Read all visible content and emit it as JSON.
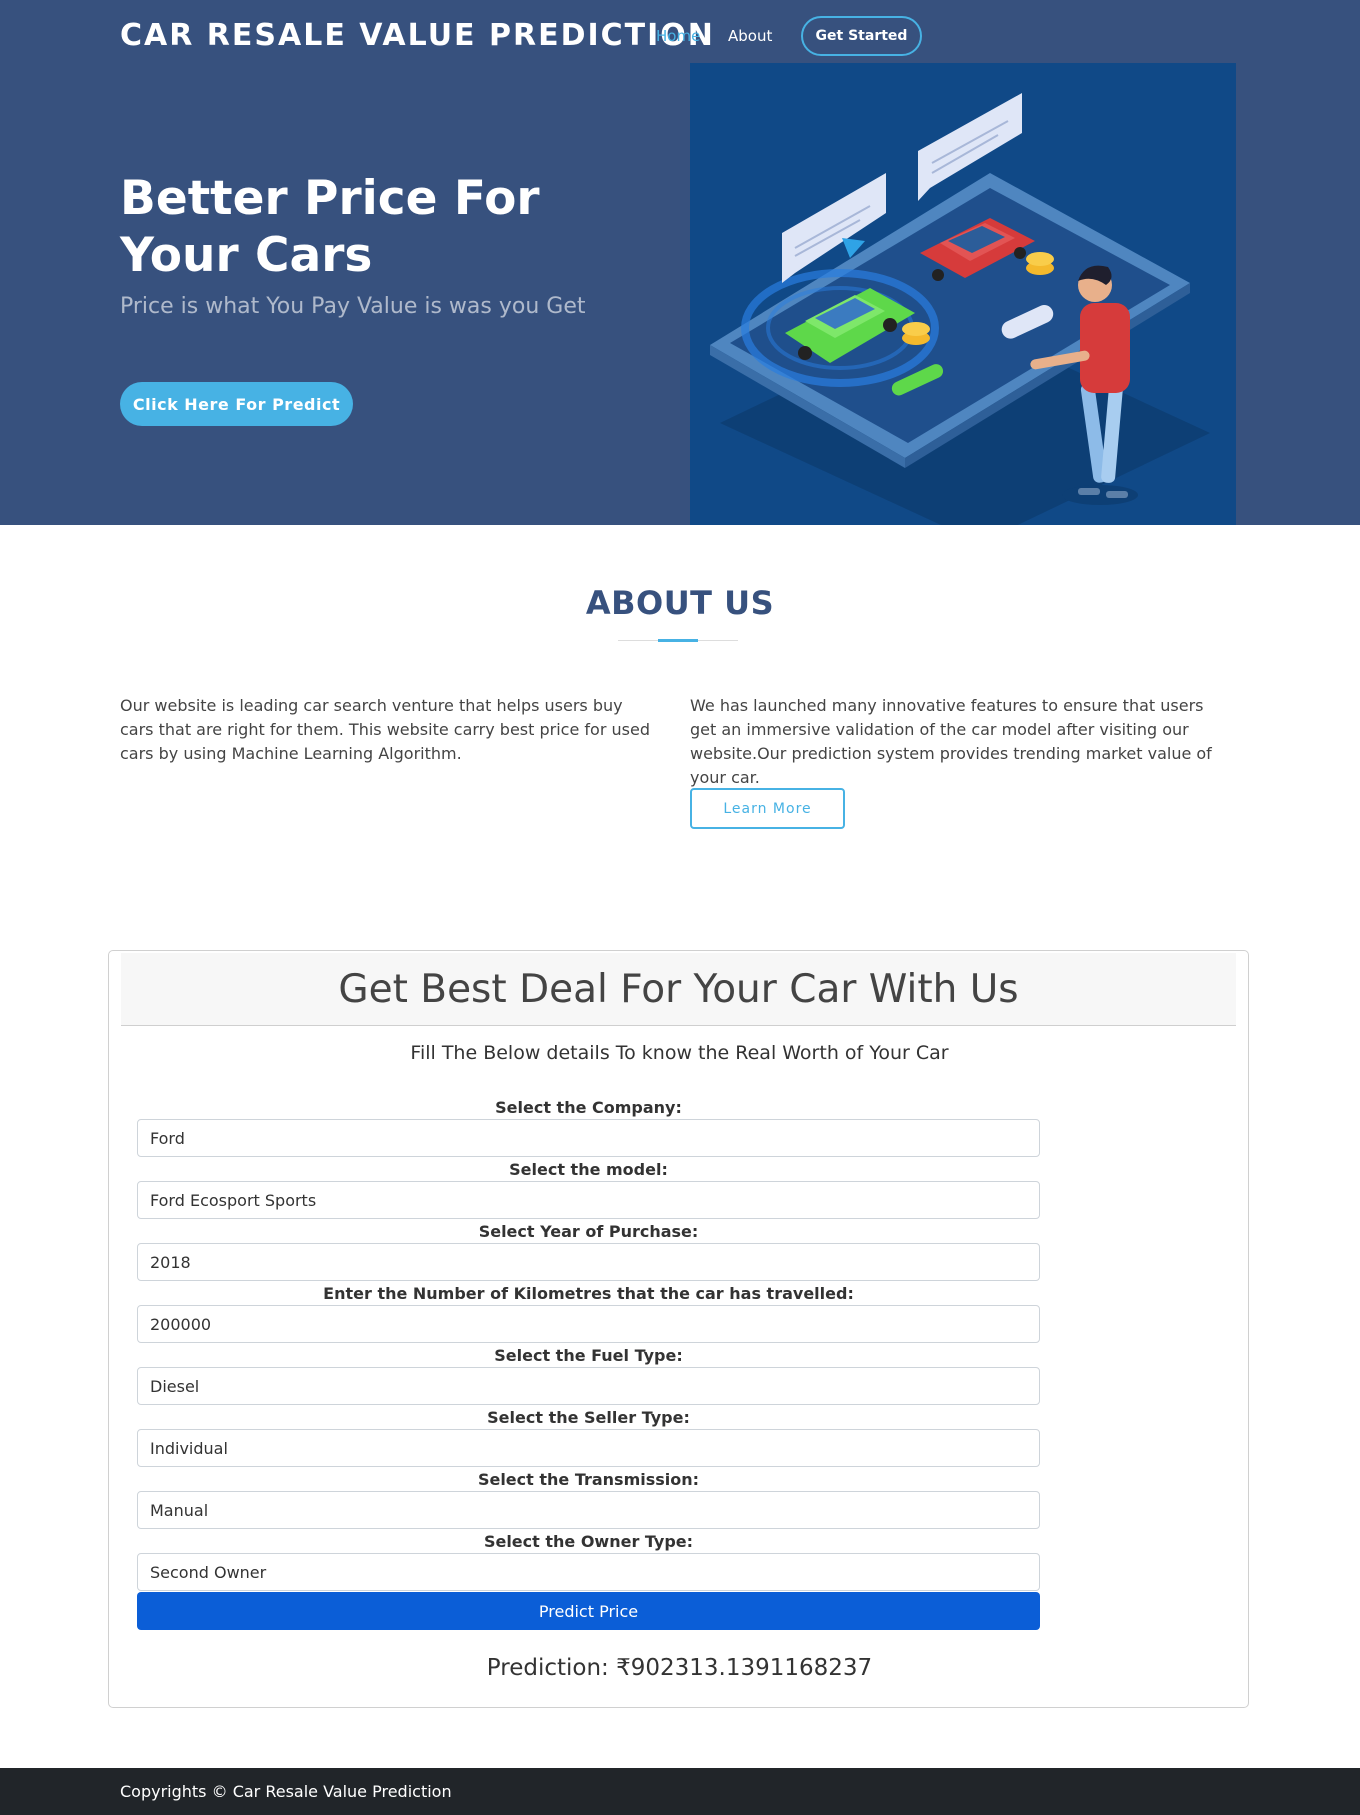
{
  "header": {
    "brand": "CAR RESALE VALUE PREDICTION",
    "nav": {
      "home": "Home",
      "about": "About",
      "cta": "Get Started"
    }
  },
  "hero": {
    "title": "Better Price For Your Cars",
    "subtitle": "Price is what You Pay Value is was you Get",
    "button": "Click Here For Predict"
  },
  "about": {
    "title": "ABOUT US",
    "left_text": "Our website is leading car search venture that helps users buy cars that are right for them. This website carry best price for used cars by using Machine Learning Algorithm.",
    "right_text": "We has launched many innovative features to ensure that users get an immersive validation of the car model after visiting our website.Our prediction system provides trending market value of your car.",
    "button": "Learn More"
  },
  "form": {
    "title": "Get Best Deal For Your Car With Us",
    "subtitle": "Fill The Below details To know the Real Worth of Your Car",
    "fields": [
      {
        "label": "Select the Company:",
        "value": "Ford"
      },
      {
        "label": "Select the model:",
        "value": "Ford Ecosport Sports"
      },
      {
        "label": "Select Year of Purchase:",
        "value": "2018"
      },
      {
        "label": "Enter the Number of Kilometres that the car has travelled:",
        "value": "200000"
      },
      {
        "label": "Select the Fuel Type:",
        "value": "Diesel"
      },
      {
        "label": "Select the Seller Type:",
        "value": "Individual"
      },
      {
        "label": "Select the Transmission:",
        "value": "Manual"
      },
      {
        "label": "Select the Owner Type:",
        "value": "Second Owner"
      }
    ],
    "submit": "Predict Price",
    "prediction": "Prediction: ₹902313.1391168237"
  },
  "footer": {
    "text": "Copyrights © Car Resale Value Prediction"
  },
  "colors": {
    "hero_bg": "#37517e",
    "accent": "#47b2e4",
    "primary_button": "#0b5ed7",
    "footer_bg": "#212529"
  }
}
